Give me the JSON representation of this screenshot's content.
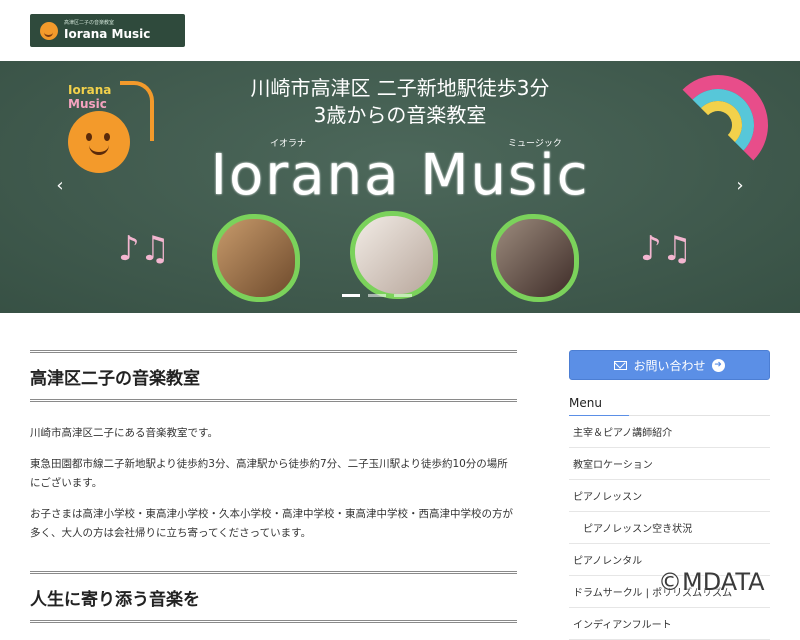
{
  "header": {
    "logo_tagline": "高津区二子の音楽教室",
    "logo_name": "Iorana Music"
  },
  "hero": {
    "line1": "川崎市高津区 二子新地駅徒歩3分",
    "line2": "3歳からの音楽教室",
    "kana_left": "イオラナ",
    "kana_right": "ミュージック",
    "title": "Iorana Music",
    "logo_text_top": "Iorana",
    "logo_text_bottom": "Music",
    "prev_glyph": "‹",
    "next_glyph": "›",
    "slide_count": 3,
    "active_slide": 1
  },
  "main": {
    "title": "高津区二子の音楽教室",
    "paragraphs": [
      "川崎市高津区二子にある音楽教室です。",
      "東急田園都市線二子新地駅より徒歩約3分、高津駅から徒歩約7分、二子玉川駅より徒歩約10分の場所にございます。",
      "お子さまは高津小学校・東高津小学校・久本小学校・高津中学校・東高津中学校・西高津中学校の方が多く、大人の方は会社帰りに立ち寄ってくださっています。"
    ],
    "second_title": "人生に寄り添う音楽を"
  },
  "sidebar": {
    "contact_label": "お問い合わせ",
    "menu_heading": "Menu",
    "items": [
      {
        "label": "主宰＆ピアノ講師紹介",
        "sub": false
      },
      {
        "label": "教室ロケーション",
        "sub": false
      },
      {
        "label": "ピアノレッスン",
        "sub": false
      },
      {
        "label": "ピアノレッスン空き状況",
        "sub": true
      },
      {
        "label": "ピアノレンタル",
        "sub": false
      },
      {
        "label": "ドラムサークル | ポリリズムリズム",
        "sub": false
      },
      {
        "label": "インディアンフルート",
        "sub": false
      }
    ]
  },
  "watermark": "©MDATA",
  "colors": {
    "hero_bg": "#3f5c4e",
    "accent": "#5b8fe6",
    "logo_bg": "#2f4a3c"
  }
}
